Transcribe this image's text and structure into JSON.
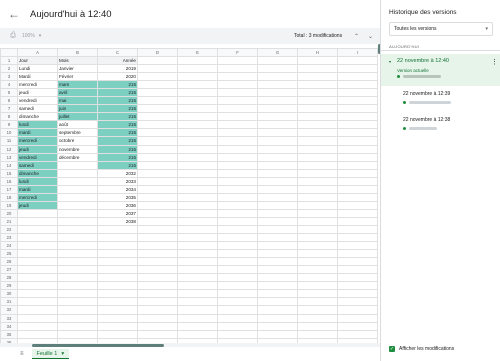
{
  "header": {
    "back_icon": "arrow-back-icon",
    "title": "Aujourd'hui à 12:40"
  },
  "toolbar": {
    "print_icon": "print-icon",
    "zoom": "100%",
    "total": "Total : 3 modifications",
    "up_icon": "chevron-up-icon",
    "down_icon": "chevron-down-icon"
  },
  "grid": {
    "columns": [
      "A",
      "B",
      "C",
      "D",
      "E",
      "F",
      "G",
      "H",
      "I"
    ],
    "rows": [
      [
        "1",
        "Jour",
        "Mois",
        "Année"
      ],
      [
        "2",
        "Lundi",
        "Janvier",
        "2019"
      ],
      [
        "3",
        "Mardi",
        "Février",
        "2020"
      ],
      [
        "4",
        "mercredi",
        "mars",
        "215"
      ],
      [
        "5",
        "jeudi",
        "avril",
        "215"
      ],
      [
        "6",
        "vendredi",
        "mai",
        "215"
      ],
      [
        "7",
        "samedi",
        "juin",
        "215"
      ],
      [
        "8",
        "dimanche",
        "juillet",
        "215"
      ],
      [
        "9",
        "lundi",
        "août",
        "215"
      ],
      [
        "10",
        "mardi",
        "septembre",
        "215"
      ],
      [
        "11",
        "mercredi",
        "octobre",
        "215"
      ],
      [
        "12",
        "jeudi",
        "novembre",
        "215"
      ],
      [
        "13",
        "vendredi",
        "décembre",
        "215"
      ],
      [
        "14",
        "samedi",
        "",
        "215"
      ],
      [
        "15",
        "dimanche",
        "",
        "2032"
      ],
      [
        "16",
        "lundi",
        "",
        "2033"
      ],
      [
        "17",
        "mardi",
        "",
        "2034"
      ],
      [
        "18",
        "mercredi",
        "",
        "2035"
      ],
      [
        "19",
        "jeudi",
        "",
        "2036"
      ],
      [
        "20",
        "",
        "",
        "2037"
      ],
      [
        "21",
        "",
        "",
        "2038"
      ],
      [
        "22",
        "",
        "",
        ""
      ],
      [
        "23",
        "",
        "",
        ""
      ],
      [
        "24",
        "",
        "",
        ""
      ],
      [
        "25",
        "",
        "",
        ""
      ],
      [
        "26",
        "",
        "",
        ""
      ],
      [
        "27",
        "",
        "",
        ""
      ],
      [
        "28",
        "",
        "",
        ""
      ],
      [
        "29",
        "",
        "",
        ""
      ],
      [
        "30",
        "",
        "",
        ""
      ],
      [
        "31",
        "",
        "",
        ""
      ],
      [
        "32",
        "",
        "",
        ""
      ],
      [
        "33",
        "",
        "",
        ""
      ],
      [
        "34",
        "",
        "",
        ""
      ],
      [
        "35",
        "",
        "",
        ""
      ],
      [
        "36",
        "",
        "",
        ""
      ]
    ],
    "highlight_color": "#7dcfc2"
  },
  "bottom": {
    "sheets_icon": "list-icon",
    "sheet_tab": "Feuille 1",
    "tab_caret_icon": "caret-down-icon"
  },
  "panel": {
    "title": "Historique des versions",
    "filter": "Toutes les versions",
    "section": "AUJOURD'HUI",
    "versions": [
      {
        "title": "22 novembre à 12:40",
        "subtitle": "Version actuelle"
      },
      {
        "title": "22 novembre à 12:39"
      },
      {
        "title": "22 novembre à 12:38"
      }
    ],
    "show_changes": "Afficher les modifications",
    "accent": "#137333"
  }
}
